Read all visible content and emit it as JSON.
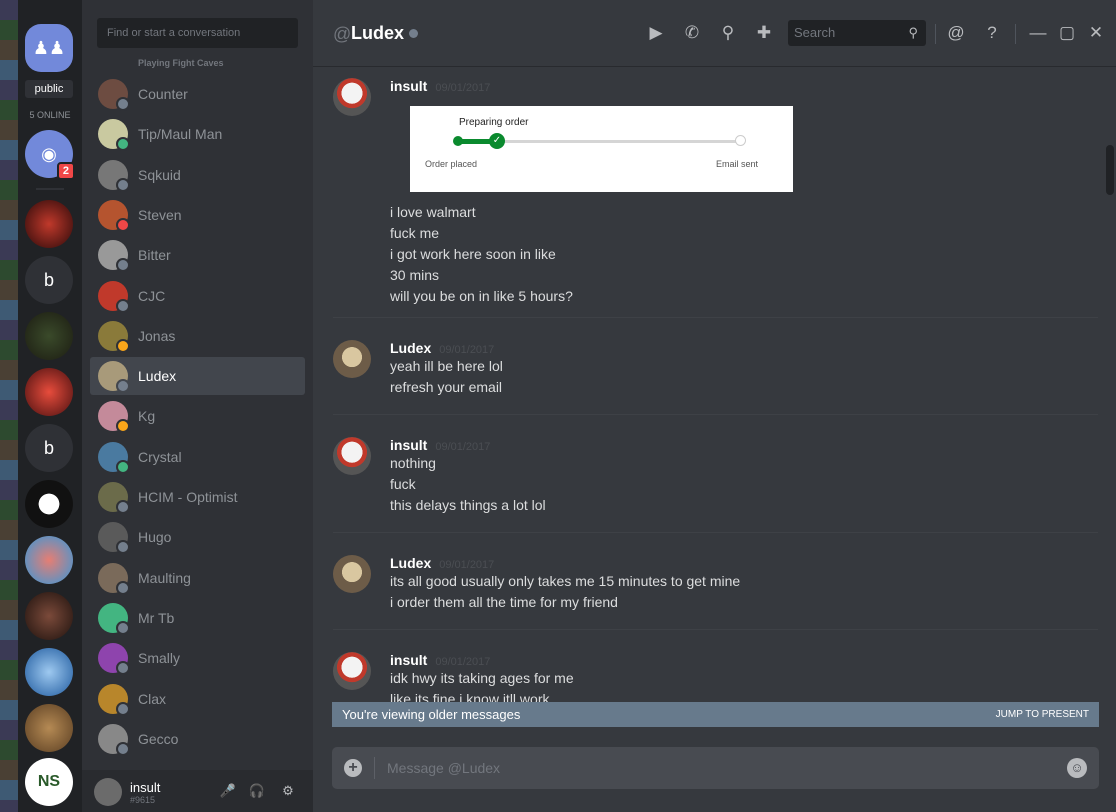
{
  "servers": {
    "public_label": "public",
    "online_label": "5 ONLINE",
    "discord_badge": "2",
    "letter_a": "b",
    "letter_b": "b"
  },
  "dms": {
    "search_placeholder": "Find or start a conversation",
    "playing_text": "Playing Fight Caves",
    "items": [
      {
        "name": "Counter",
        "status_color": "#747f8d"
      },
      {
        "name": "Tip/Maul Man",
        "status_color": "#43b581"
      },
      {
        "name": "Sqkuid",
        "status_color": "#747f8d"
      },
      {
        "name": "Steven",
        "status_color": "#f04747"
      },
      {
        "name": "Bitter",
        "status_color": "#747f8d"
      },
      {
        "name": "CJC",
        "status_color": "#747f8d"
      },
      {
        "name": "Jonas",
        "status_color": "#faa61a"
      },
      {
        "name": "Ludex",
        "status_color": "#747f8d"
      },
      {
        "name": "Kg",
        "status_color": "#faa61a"
      },
      {
        "name": "Crystal",
        "status_color": "#43b581"
      },
      {
        "name": "HCIM - Optimist",
        "status_color": "#747f8d"
      },
      {
        "name": "Hugo",
        "status_color": "#747f8d"
      },
      {
        "name": "Maulting",
        "status_color": "#747f8d"
      },
      {
        "name": "Mr Tb",
        "status_color": "#747f8d"
      },
      {
        "name": "Smally",
        "status_color": "#747f8d"
      },
      {
        "name": "Clax",
        "status_color": "#747f8d"
      },
      {
        "name": "Gecco",
        "status_color": "#747f8d"
      }
    ]
  },
  "user": {
    "name": "insult",
    "tag": "#9615"
  },
  "header": {
    "at": "@",
    "name": "Ludex",
    "search_placeholder": "Search"
  },
  "messages": [
    {
      "author": "insult",
      "time": "09/01/2017",
      "lines": [
        "i love walmart",
        "fuck me",
        "i got work here soon in like",
        "30 mins",
        "will you be on in like 5 hours?"
      ]
    },
    {
      "author": "Ludex",
      "time": "09/01/2017",
      "lines": [
        "yeah ill be here lol",
        "refresh your email"
      ]
    },
    {
      "author": "insult",
      "time": "09/01/2017",
      "lines": [
        "nothing",
        "fuck",
        "this delays things a lot lol"
      ]
    },
    {
      "author": "Ludex",
      "time": "09/01/2017",
      "lines": [
        "its all good usually only takes me 15 minutes to get mine",
        "i order them all the time for my friend"
      ]
    },
    {
      "author": "insult",
      "time": "09/01/2017",
      "lines": [
        "idk hwy its taking ages for me",
        "like its fine i know itll work"
      ]
    }
  ],
  "embed": {
    "title": "Preparing order",
    "label_left": "Order placed",
    "label_right": "Email sent"
  },
  "older_bar": {
    "text": "You're viewing older messages",
    "jump": "JUMP TO PRESENT"
  },
  "composer": {
    "placeholder": "Message @Ludex"
  }
}
